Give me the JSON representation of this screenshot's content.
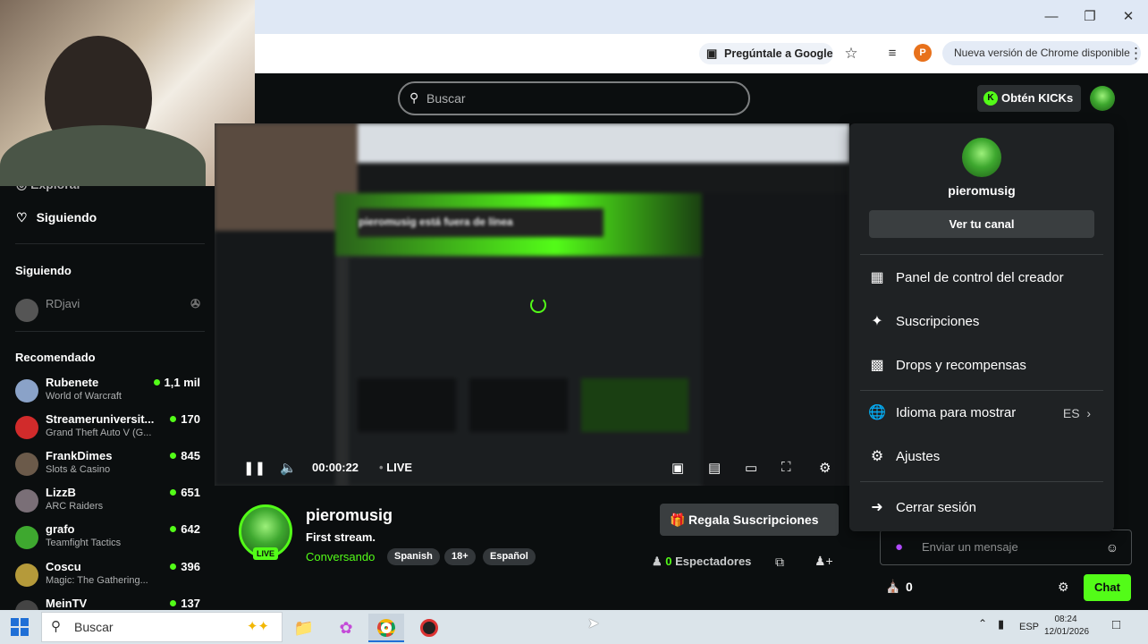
{
  "browser": {
    "ask_google": "Pregúntale a Google",
    "profile_initial": "P",
    "update_notice": "Nueva versión de Chrome disponible",
    "window_controls": [
      "minimize-icon",
      "restore-icon",
      "close-icon"
    ]
  },
  "header": {
    "search_placeholder": "Buscar",
    "kicks_label": "Obtén KICKs"
  },
  "sidebar": {
    "nav": {
      "explore": "Explorar",
      "following": "Siguiendo"
    },
    "following_title": "Siguiendo",
    "following_items": [
      {
        "name": "RDjavi"
      }
    ],
    "recommended_title": "Recomendado",
    "recommended": [
      {
        "name": "Rubenete",
        "game": "World of Warcraft",
        "viewers": "1,1 mil"
      },
      {
        "name": "Streameruniversit...",
        "game": "Grand Theft Auto V (G...",
        "viewers": "170"
      },
      {
        "name": "FrankDimes",
        "game": "Slots & Casino",
        "viewers": "845"
      },
      {
        "name": "LizzB",
        "game": "ARC Raiders",
        "viewers": "651"
      },
      {
        "name": "grafo",
        "game": "Teamfight Tactics",
        "viewers": "642"
      },
      {
        "name": "Coscu",
        "game": "Magic: The Gathering...",
        "viewers": "396"
      },
      {
        "name": "MeinTV",
        "game": "",
        "viewers": "137"
      }
    ]
  },
  "player": {
    "time": "00:00:22",
    "live": "LIVE",
    "offline_text": "pieromusig está fuera de línea"
  },
  "stream": {
    "channel": "pieromusig",
    "title": "First stream.",
    "category": "Conversando",
    "live_badge": "LIVE",
    "tags": [
      "Spanish",
      "18+",
      "Español"
    ],
    "gift_label": "Regala Suscripciones",
    "viewers_count": "0",
    "viewers_label": "Espectadores"
  },
  "chat": {
    "input_placeholder": "Enviar un mensaje",
    "store_count": "0",
    "chat_button": "Chat"
  },
  "dropdown": {
    "username": "pieromusig",
    "view_channel": "Ver tu canal",
    "items": [
      {
        "label": "Panel de control del creador"
      },
      {
        "label": "Suscripciones"
      },
      {
        "label": "Drops y recompensas"
      },
      {
        "label": "Idioma para mostrar",
        "value": "ES"
      },
      {
        "label": "Ajustes"
      },
      {
        "label": "Cerrar sesión"
      }
    ]
  },
  "taskbar": {
    "search_placeholder": "Buscar",
    "language": "ESP",
    "time": "08:24",
    "date": "12/01/2026"
  },
  "colors": {
    "accent": "#53fc18",
    "bg": "#0b0e0f",
    "panel": "#1f2224"
  }
}
